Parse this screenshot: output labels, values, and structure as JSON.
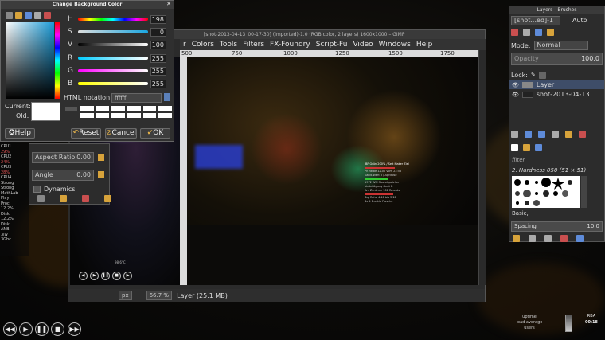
{
  "color_dialog": {
    "title": "Change Background Color",
    "sliders": [
      {
        "label": "H",
        "value": "198",
        "color": "linear-gradient(to right,#f00,#ff0,#0f0,#0ff,#00f,#f0f,#f00)"
      },
      {
        "label": "S",
        "value": "0",
        "color": "linear-gradient(to right,#ccc,#1aa6e0)"
      },
      {
        "label": "V",
        "value": "100",
        "color": "linear-gradient(to right,#000,#fff)"
      },
      {
        "label": "R",
        "value": "255",
        "color": "linear-gradient(to right,#0cf,#fff)"
      },
      {
        "label": "G",
        "value": "255",
        "color": "linear-gradient(to right,#f0f,#fff)"
      },
      {
        "label": "B",
        "value": "255",
        "color": "linear-gradient(to right,#ff0,#fff)"
      }
    ],
    "current_label": "Current:",
    "old_label": "Old:",
    "html_notation_label": "HTML notation:",
    "html_notation_value": "ffffff",
    "help_label": "Help",
    "reset_label": "Reset",
    "cancel_label": "Cancel",
    "ok_label": "OK"
  },
  "image_window": {
    "title": "[shot-2013-04-13_00-17-30] (imported)-1.0 (RGB color, 2 layers) 1600x1000 – GIMP",
    "menus": [
      "r",
      "Colors",
      "Tools",
      "Filters",
      "FX-Foundry",
      "Script-Fu",
      "Video",
      "Windows",
      "Help"
    ],
    "ruler_marks": [
      "500",
      "750",
      "1000",
      "1250",
      "1500",
      "1750"
    ],
    "unit": "px",
    "zoom": "66.7 %",
    "status": "Layer (25.1 MB)"
  },
  "layers_dock": {
    "title": "Layers - Brushes",
    "image_menu": "[shot...ed]-1",
    "auto_label": "Auto",
    "mode_label": "Mode:",
    "mode_value": "Normal",
    "opacity_label": "Opacity",
    "opacity_value": "100.0",
    "lock_label": "Lock:",
    "layers": [
      {
        "name": "Layer"
      },
      {
        "name": "shot-2013-04-13"
      }
    ],
    "brush_filter": "filter",
    "brush_name": "2. Hardness 050 (51 × 51)",
    "brush_tag": "Basic,",
    "spacing_label": "Spacing",
    "spacing_value": "10.0"
  },
  "tool_options": {
    "aspect_ratio_label": "Aspect Ratio",
    "aspect_ratio_value": "0.00",
    "angle_label": "Angle",
    "angle_value": "0.00",
    "dynamics_label": "Dynamics"
  },
  "sysmon": {
    "lines": [
      "CPU1",
      "29%",
      "CPU2",
      "24%",
      "CPU3",
      "28%",
      "CPU4",
      "",
      "Strong",
      "Strong",
      "MathLab",
      "",
      "Play",
      "",
      "Proc",
      "12.2%",
      "Disk",
      "12.2%",
      "Disk",
      "ANB",
      "3iw",
      "3Gbc"
    ]
  },
  "desktop": {
    "uptime_label": "uptime",
    "load_label": "load average",
    "users_label": "users",
    "clock_small": "RBA",
    "clock_time": "00:18"
  },
  "canvas_overlay": {
    "label": "98.6°C",
    "lines": [
      "IBF Grün 200% / Seit Maker Ziel",
      "Ph Farbe 12.00 vom 23:58",
      "Kalbs Wert 5 / Aprikose",
      "1972 WM Soundspeicher",
      "Verteidigung Gent B",
      "Am Zentrum 108 Rounds",
      "Tag Ruhe 4.28 bis 3:28",
      "4x 4 Dunkle Flasche"
    ]
  }
}
